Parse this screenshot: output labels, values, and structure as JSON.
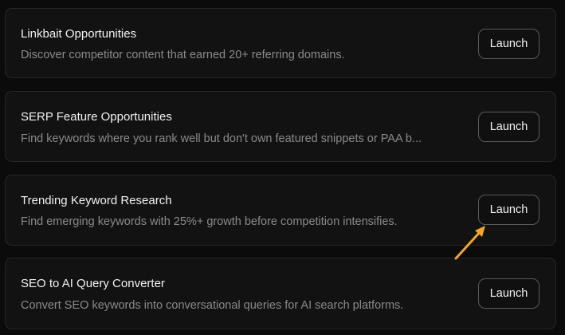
{
  "cards": [
    {
      "title": "Linkbait Opportunities",
      "description": "Discover competitor content that earned 20+ referring domains.",
      "button_label": "Launch"
    },
    {
      "title": "SERP Feature Opportunities",
      "description": "Find keywords where you rank well but don't own featured snippets or PAA b...",
      "button_label": "Launch"
    },
    {
      "title": "Trending Keyword Research",
      "description": "Find emerging keywords with 25%+ growth before competition intensifies.",
      "button_label": "Launch"
    },
    {
      "title": "SEO to AI Query Converter",
      "description": "Convert SEO keywords into conversational queries for AI search platforms.",
      "button_label": "Launch"
    }
  ],
  "colors": {
    "background": "#0b0b0b",
    "card": "#121212",
    "title": "#f2f2f2",
    "description": "#8a8a8a",
    "annotation_arrow": "#f5a623"
  },
  "icons": {
    "annotation": "arrow-pointer-icon"
  }
}
